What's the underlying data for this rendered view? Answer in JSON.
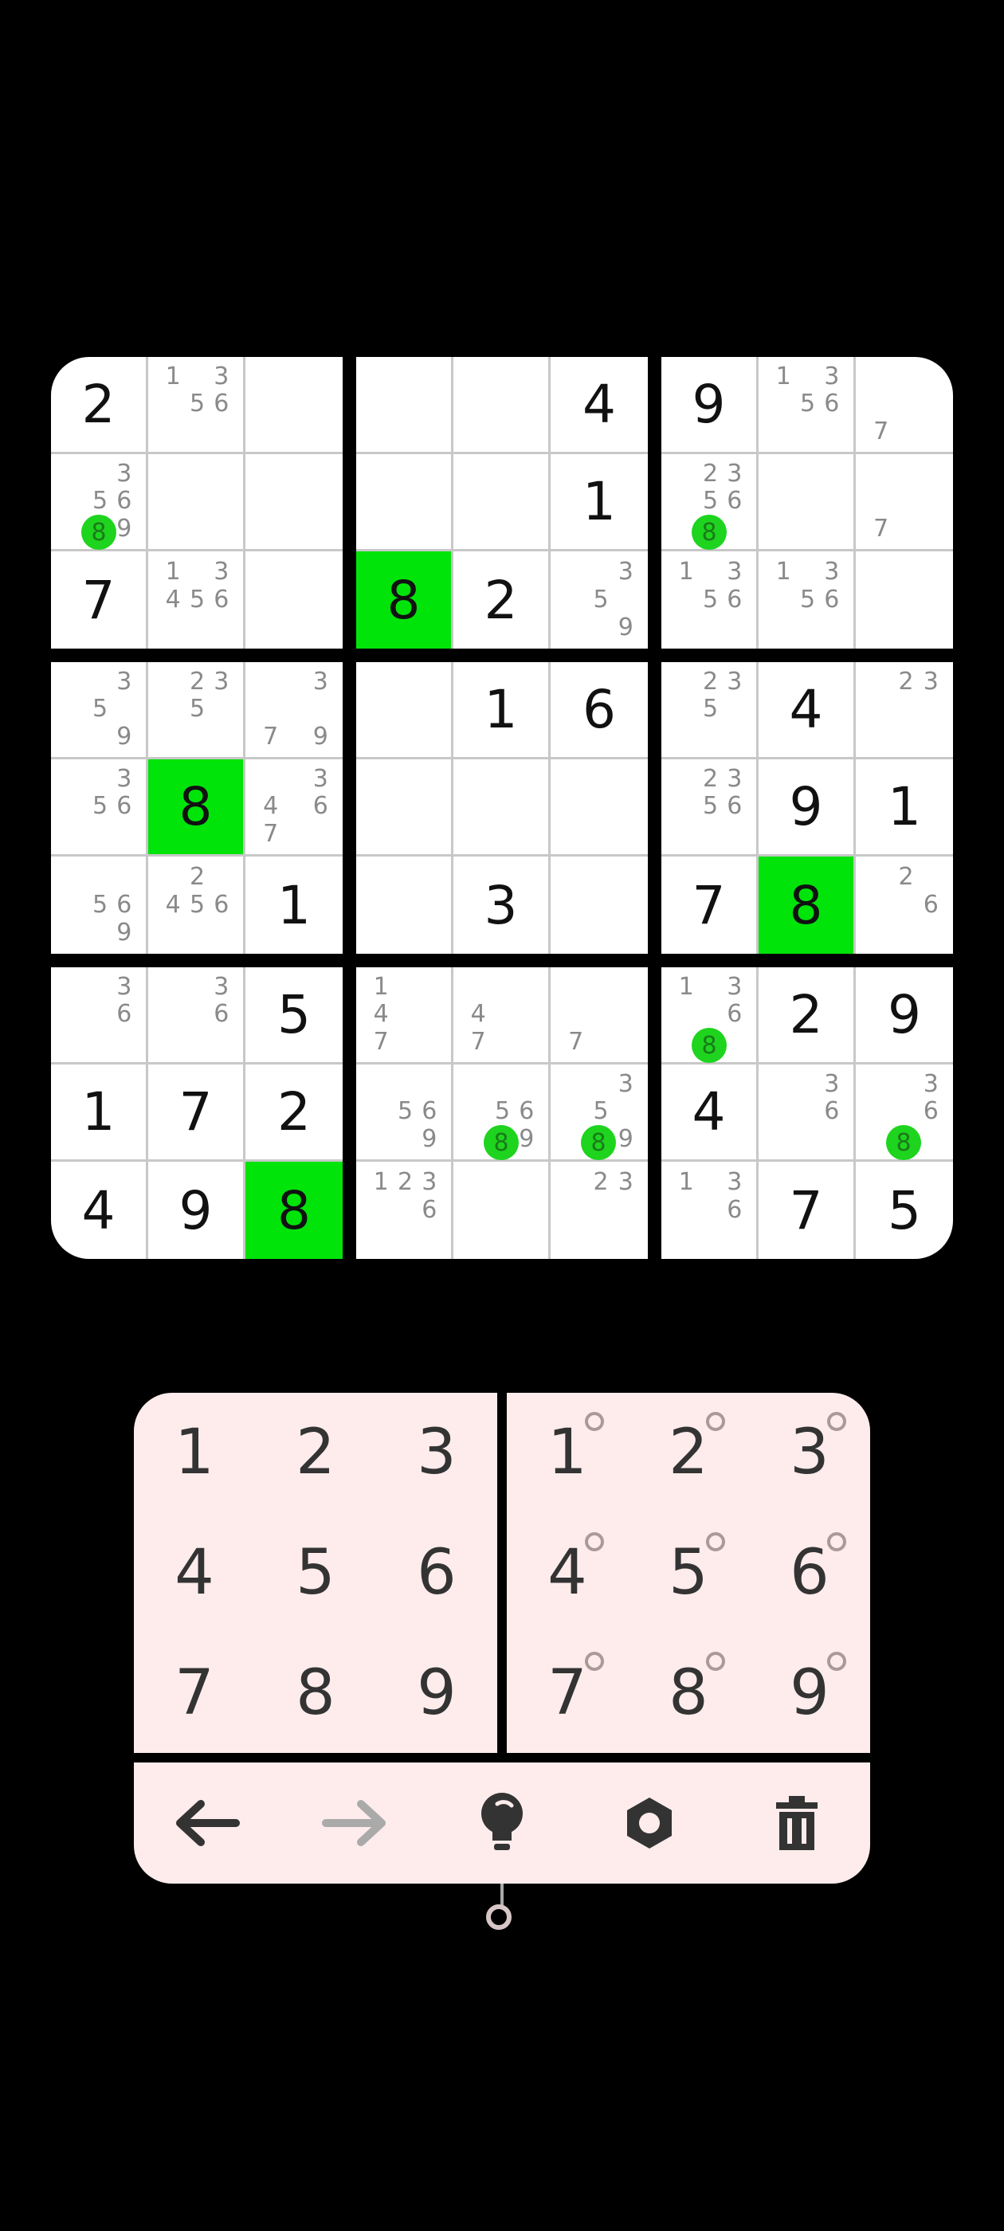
{
  "board": {
    "boxes": [
      [
        {
          "v": "2"
        },
        {
          "n": [
            "1",
            "",
            "3",
            "",
            "5",
            "6",
            "",
            "",
            ""
          ]
        },
        {},
        {
          "n": [
            "",
            "",
            "3",
            "",
            "5",
            "6",
            "",
            "",
            "9"
          ],
          "dot": "8"
        },
        {},
        {},
        {
          "v": "7"
        },
        {
          "n": [
            "1",
            "",
            "3",
            "4",
            "5",
            "6",
            "",
            "",
            ""
          ]
        },
        {}
      ],
      [
        {},
        {},
        {
          "v": "4"
        },
        {},
        {},
        {
          "v": "1"
        },
        {
          "v": "8",
          "hl": true
        },
        {
          "v": "2"
        },
        {
          "n": [
            "",
            "",
            "3",
            "",
            "5",
            "",
            "",
            "",
            "9"
          ]
        }
      ],
      [
        {
          "v": "9"
        },
        {
          "n": [
            "1",
            "",
            "3",
            "",
            "5",
            "6",
            "",
            "",
            ""
          ]
        },
        {
          "n": [
            "",
            "",
            "",
            "",
            "",
            "",
            "7",
            "",
            ""
          ]
        },
        {
          "n": [
            "",
            "2",
            "3",
            "",
            "5",
            "6",
            "",
            "",
            ""
          ],
          "dot": "8"
        },
        {},
        {
          "n": [
            "",
            "",
            "",
            "",
            "",
            "",
            "7",
            "",
            ""
          ]
        },
        {
          "n": [
            "1",
            "",
            "3",
            "",
            "5",
            "6",
            "",
            "",
            ""
          ]
        },
        {
          "n": [
            "1",
            "",
            "3",
            "",
            "5",
            "6",
            "",
            "",
            ""
          ]
        },
        {}
      ],
      [
        {
          "n": [
            "",
            "",
            "3",
            "",
            "5",
            "",
            "",
            "",
            "9"
          ]
        },
        {
          "n": [
            "",
            "2",
            "3",
            "",
            "5",
            "",
            "",
            "",
            ""
          ]
        },
        {
          "n": [
            "",
            "",
            "3",
            "",
            "",
            "",
            "7",
            "",
            "9"
          ]
        },
        {
          "n": [
            "",
            "",
            "3",
            "",
            "5",
            "6",
            "",
            "",
            ""
          ]
        },
        {
          "v": "8",
          "hl": true
        },
        {
          "n": [
            "",
            "",
            "3",
            "4",
            "",
            "6",
            "7",
            "",
            ""
          ]
        },
        {
          "n": [
            "",
            "",
            "",
            "",
            "5",
            "6",
            "",
            "",
            "9"
          ]
        },
        {
          "n": [
            "",
            "2",
            "",
            "4",
            "5",
            "6",
            "",
            "",
            ""
          ]
        },
        {
          "v": "1"
        }
      ],
      [
        {},
        {
          "v": "1"
        },
        {
          "v": "6"
        },
        {},
        {},
        {},
        {},
        {
          "v": "3"
        },
        {}
      ],
      [
        {
          "n": [
            "",
            "2",
            "3",
            "",
            "5",
            "",
            "",
            "",
            ""
          ]
        },
        {
          "v": "4"
        },
        {
          "n": [
            "",
            "2",
            "3",
            "",
            "",
            "",
            "",
            "",
            ""
          ]
        },
        {
          "n": [
            "",
            "2",
            "3",
            "",
            "5",
            "6",
            "",
            "",
            ""
          ]
        },
        {
          "v": "9"
        },
        {
          "v": "1"
        },
        {
          "v": "7"
        },
        {
          "v": "8",
          "hl": true
        },
        {
          "n": [
            "",
            "2",
            "",
            "",
            "",
            "6",
            "",
            "",
            ""
          ]
        }
      ],
      [
        {
          "n": [
            "",
            "",
            "3",
            "",
            "",
            "6",
            "",
            "",
            ""
          ]
        },
        {
          "n": [
            "",
            "",
            "3",
            "",
            "",
            "6",
            "",
            "",
            ""
          ]
        },
        {
          "v": "5"
        },
        {
          "v": "1"
        },
        {
          "v": "7"
        },
        {
          "v": "2"
        },
        {
          "v": "4"
        },
        {
          "v": "9"
        },
        {
          "v": "8",
          "hl": true
        }
      ],
      [
        {
          "n": [
            "1",
            "",
            "",
            "4",
            "",
            "",
            "7",
            "",
            ""
          ]
        },
        {
          "n": [
            "",
            "",
            "",
            "4",
            "",
            "",
            "7",
            "",
            ""
          ]
        },
        {
          "n": [
            "",
            "",
            "",
            "",
            "",
            "",
            "7",
            "",
            ""
          ]
        },
        {
          "n": [
            "",
            "",
            "",
            "",
            "5",
            "6",
            "",
            "",
            "9"
          ]
        },
        {
          "n": [
            "",
            "",
            "",
            "",
            "5",
            "6",
            "",
            "",
            "9"
          ],
          "dot": "8"
        },
        {
          "n": [
            "",
            "",
            "3",
            "",
            "5",
            "",
            "",
            "",
            "9"
          ],
          "dot": "8"
        },
        {
          "n": [
            "1",
            "2",
            "3",
            "",
            "",
            "6",
            "",
            "",
            ""
          ]
        },
        {},
        {
          "n": [
            "",
            "2",
            "3",
            "",
            "",
            "",
            "",
            "",
            ""
          ]
        }
      ],
      [
        {
          "n": [
            "1",
            "",
            "3",
            "",
            "",
            "6",
            "",
            "",
            ""
          ],
          "dot": "8"
        },
        {
          "v": "2"
        },
        {
          "v": "9"
        },
        {
          "v": "4"
        },
        {
          "n": [
            "",
            "",
            "3",
            "",
            "",
            "6",
            "",
            "",
            ""
          ]
        },
        {
          "n": [
            "",
            "",
            "3",
            "",
            "",
            "6",
            "",
            "",
            ""
          ],
          "dot": "8"
        },
        {
          "n": [
            "1",
            "",
            "3",
            "",
            "",
            "6",
            "",
            "",
            ""
          ]
        },
        {
          "v": "7"
        },
        {
          "v": "5"
        }
      ]
    ]
  },
  "keypad_numbers": [
    "1",
    "2",
    "3",
    "4",
    "5",
    "6",
    "7",
    "8",
    "9"
  ],
  "keypad_notes": [
    "1",
    "2",
    "3",
    "4",
    "5",
    "6",
    "7",
    "8",
    "9"
  ],
  "toolbar": [
    {
      "name": "undo-icon"
    },
    {
      "name": "redo-icon"
    },
    {
      "name": "hint-icon"
    },
    {
      "name": "settings-icon"
    },
    {
      "name": "delete-icon"
    }
  ],
  "colors": {
    "highlight": "#00e40a",
    "candidate_dot": "#1ed41e",
    "panel": "#fdeceb"
  }
}
